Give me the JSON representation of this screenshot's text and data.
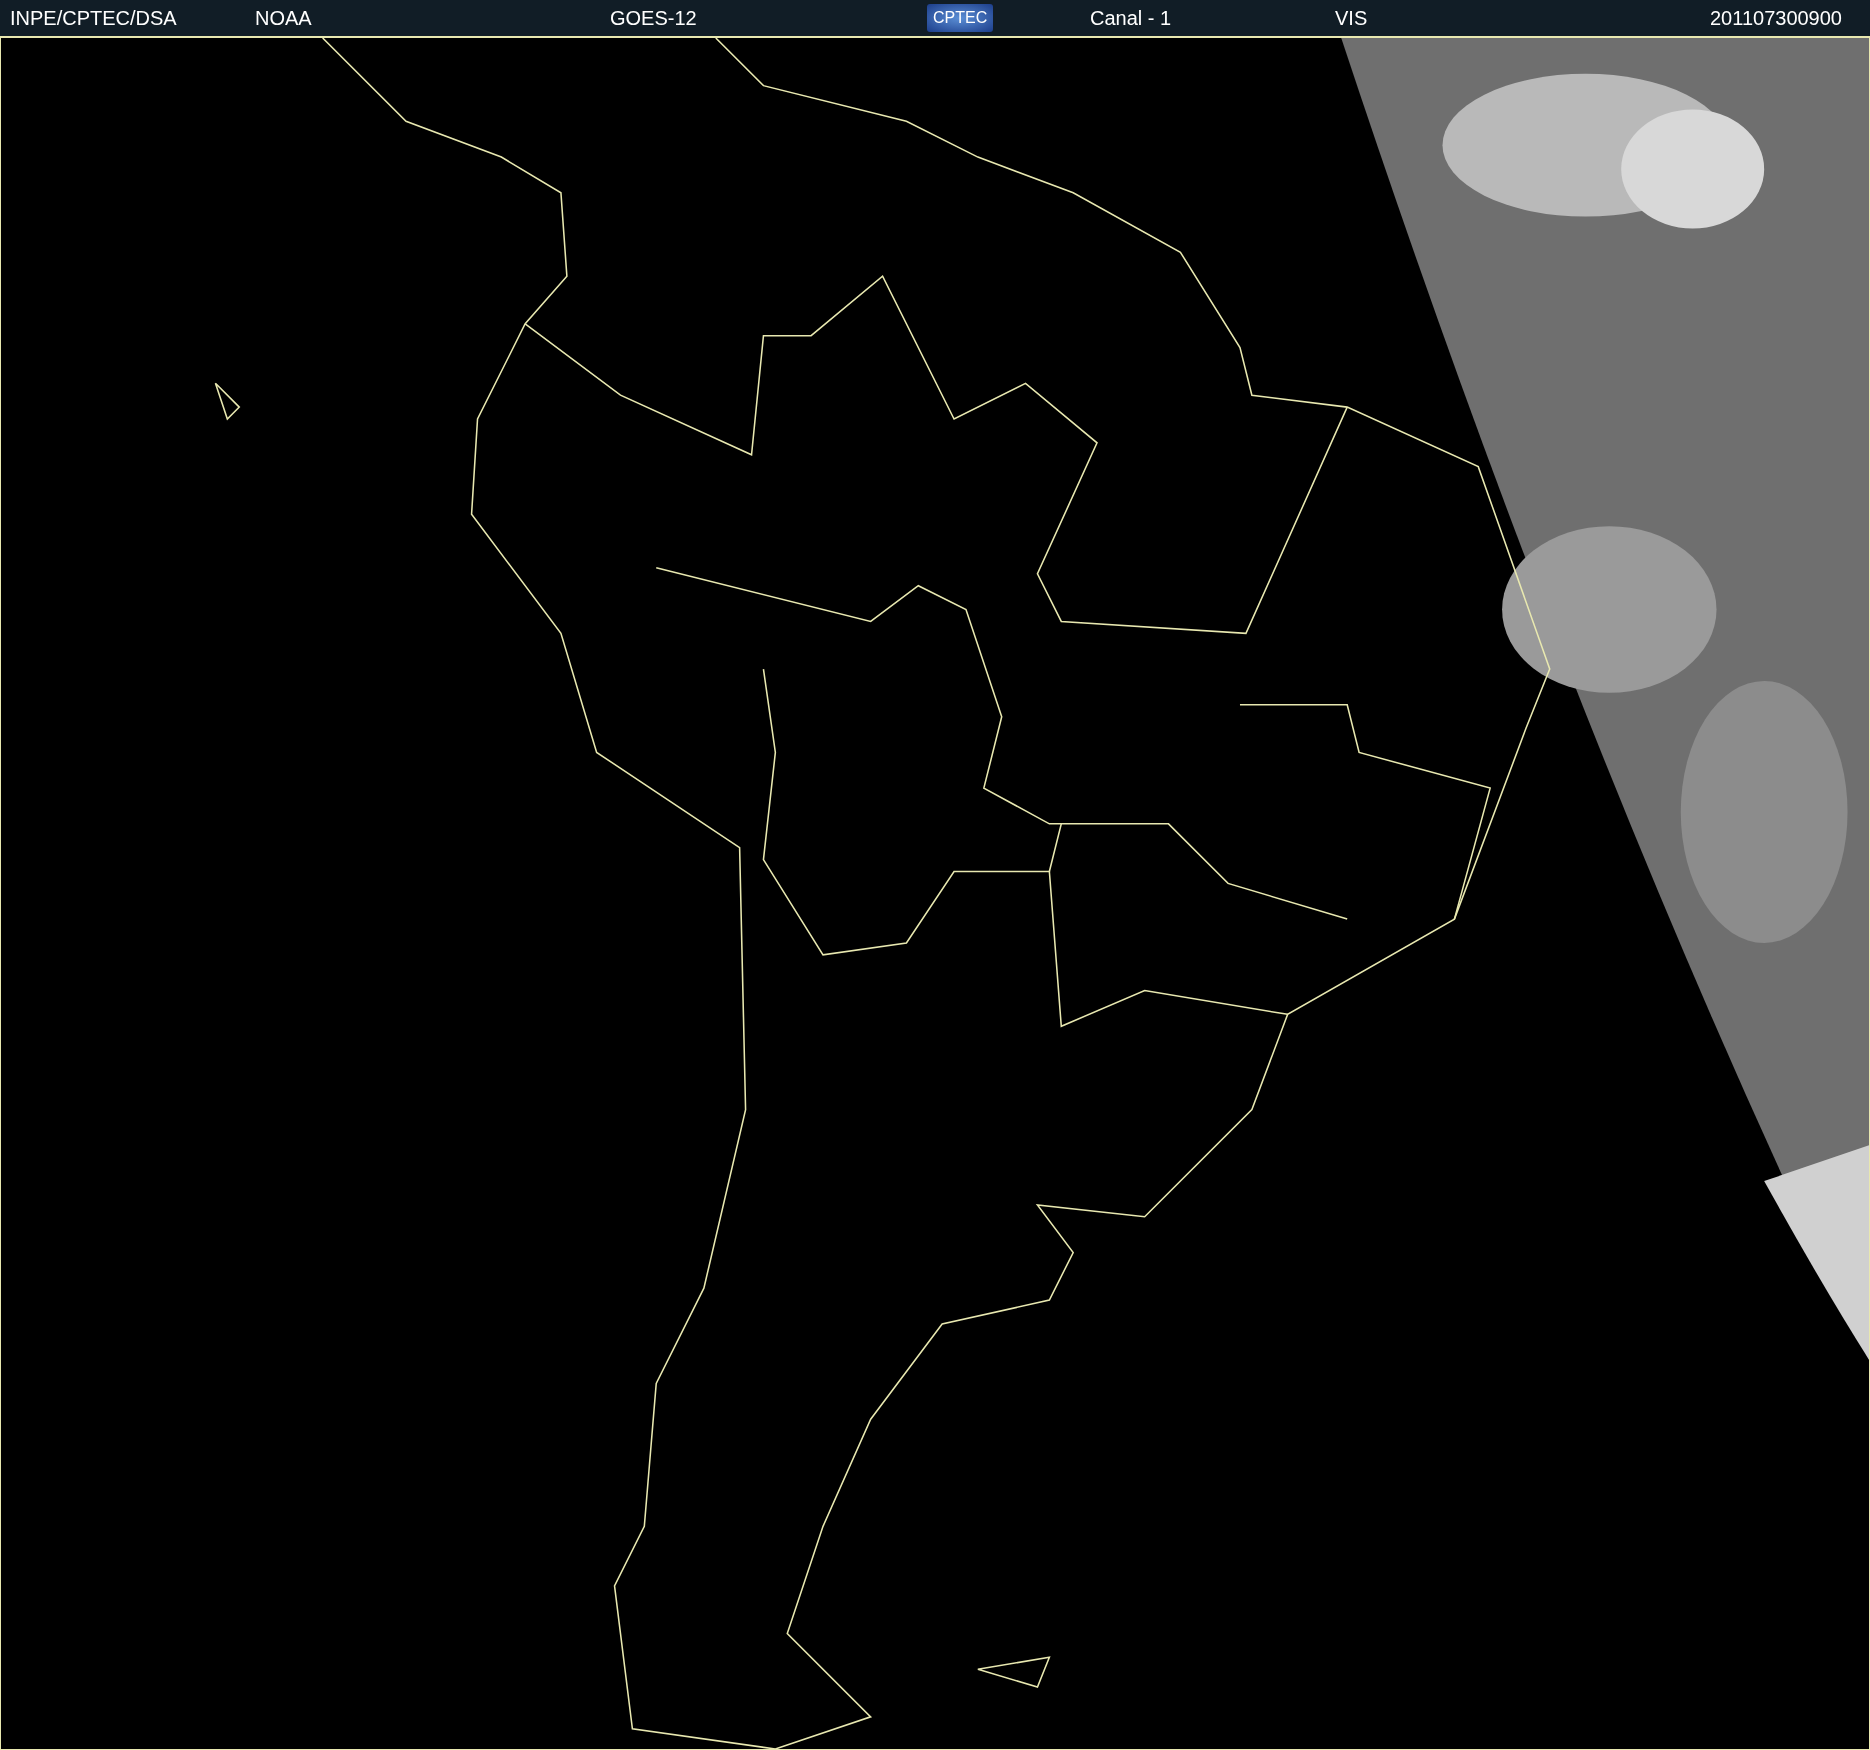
{
  "header": {
    "items": [
      {
        "kind": "text",
        "text": "INPE/CPTEC/DSA"
      },
      {
        "kind": "text",
        "text": "NOAA"
      },
      {
        "kind": "text",
        "text": "GOES-12"
      },
      {
        "kind": "logo",
        "text": "CPTEC"
      },
      {
        "kind": "text",
        "text": "Canal - 1"
      },
      {
        "kind": "text",
        "text": "VIS"
      },
      {
        "kind": "text",
        "text": "201107300900"
      }
    ]
  }
}
